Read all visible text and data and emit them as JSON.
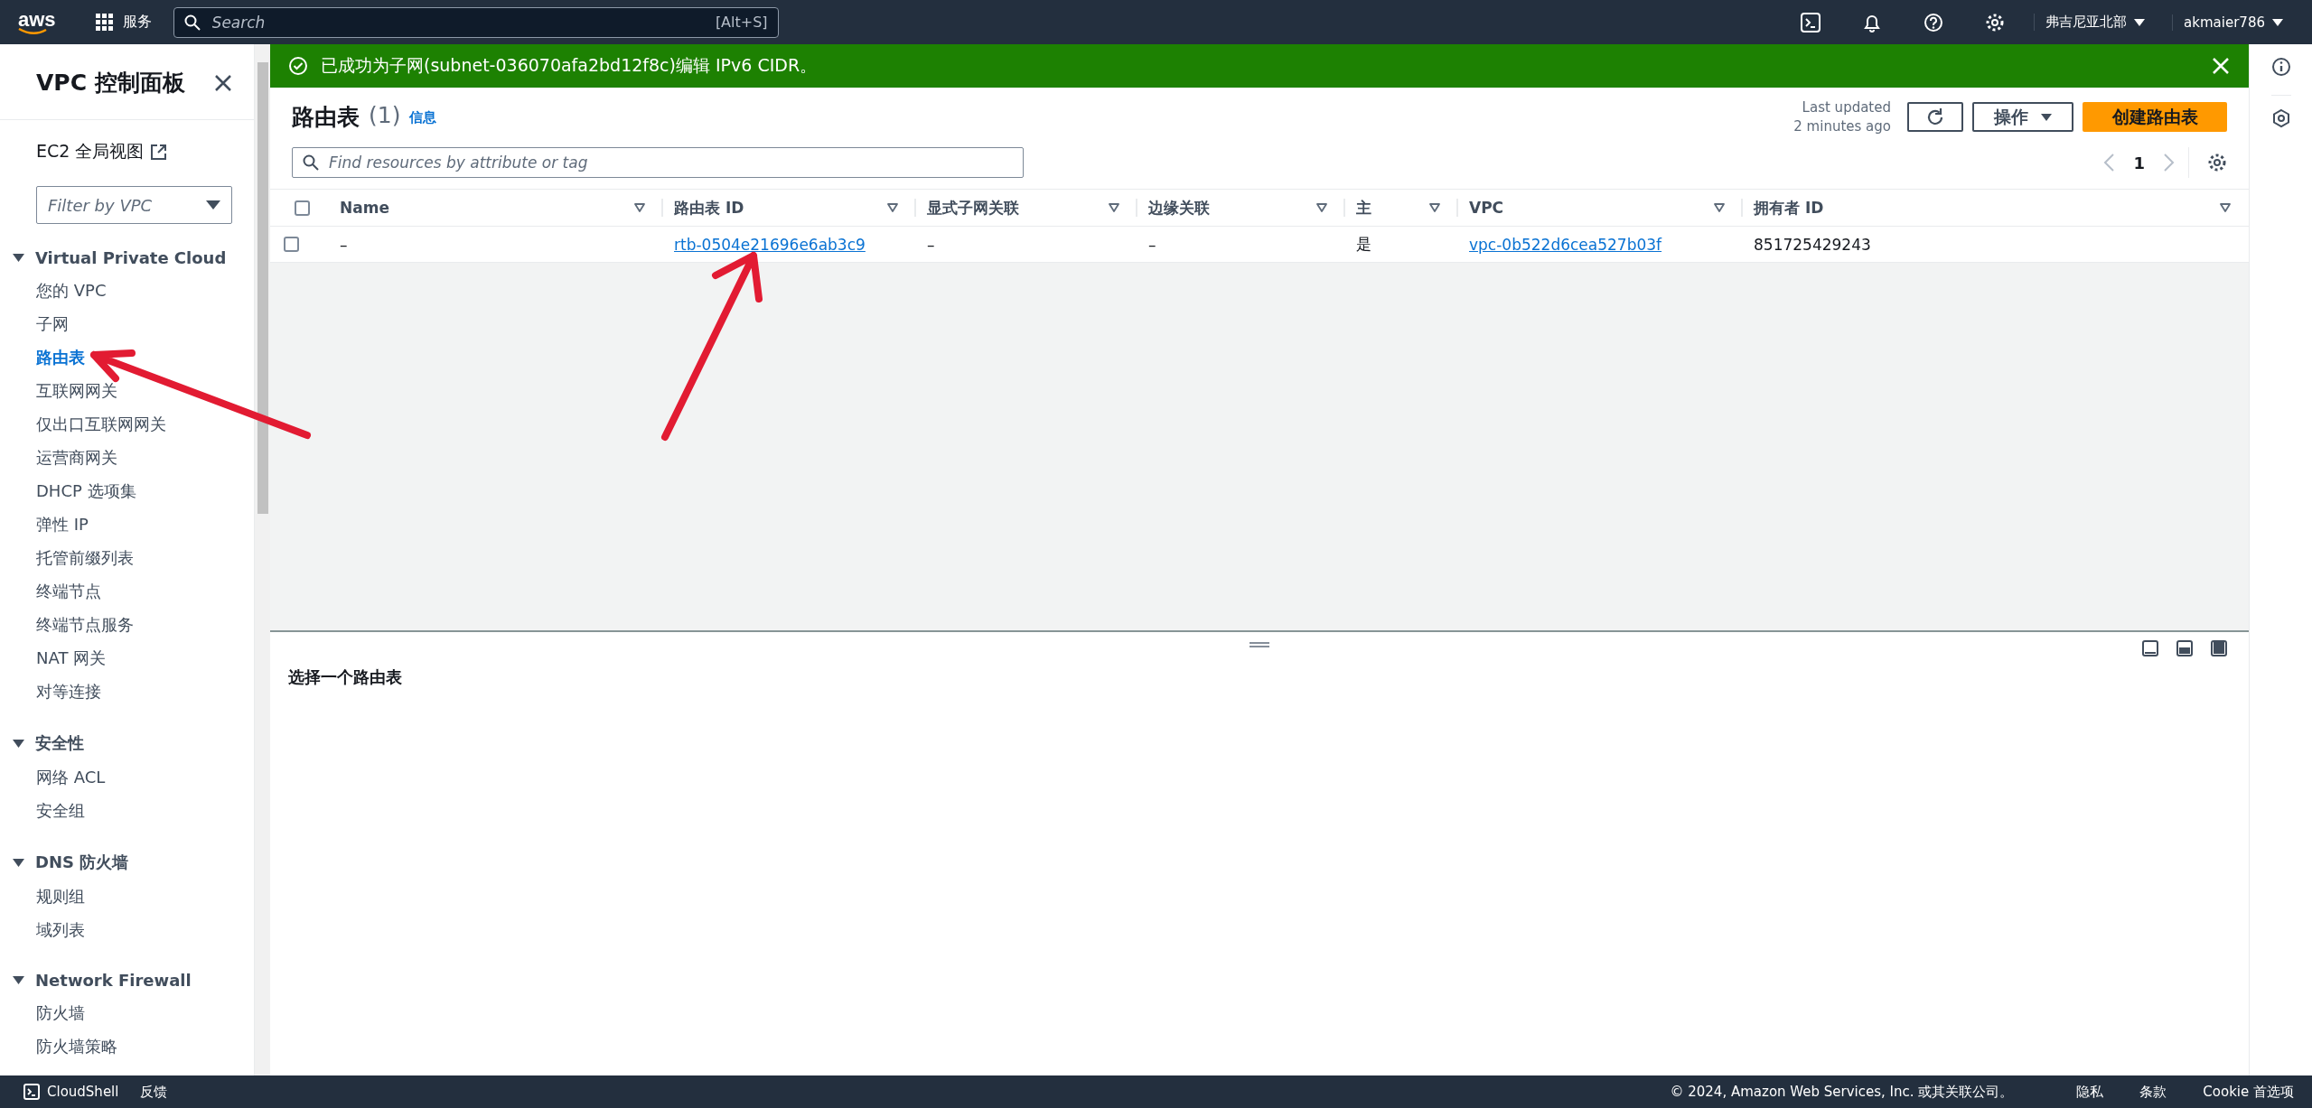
{
  "top_bar": {
    "logo": "aws",
    "services_label": "服务",
    "search": {
      "placeholder": "Search",
      "shortcut": "[Alt+S]"
    },
    "region": "弗吉尼亚北部",
    "user": "akmaier786"
  },
  "sidebar": {
    "title": "VPC 控制面板",
    "global_view_link": "EC2 全局视图",
    "vpc_filter": {
      "placeholder": "Filter by VPC"
    },
    "sections": [
      {
        "title": "Virtual Private Cloud",
        "expanded": true,
        "items": [
          {
            "label": "您的 VPC",
            "selected": false
          },
          {
            "label": "子网",
            "selected": false
          },
          {
            "label": "路由表",
            "selected": true
          },
          {
            "label": "互联网网关",
            "selected": false
          },
          {
            "label": "仅出口互联网网关",
            "selected": false
          },
          {
            "label": "运营商网关",
            "selected": false
          },
          {
            "label": "DHCP 选项集",
            "selected": false
          },
          {
            "label": "弹性 IP",
            "selected": false
          },
          {
            "label": "托管前缀列表",
            "selected": false
          },
          {
            "label": "终端节点",
            "selected": false
          },
          {
            "label": "终端节点服务",
            "selected": false
          },
          {
            "label": "NAT 网关",
            "selected": false
          },
          {
            "label": "对等连接",
            "selected": false
          }
        ]
      },
      {
        "title": "安全性",
        "expanded": true,
        "items": [
          {
            "label": "网络 ACL",
            "selected": false
          },
          {
            "label": "安全组",
            "selected": false
          }
        ]
      },
      {
        "title": "DNS 防火墙",
        "expanded": true,
        "items": [
          {
            "label": "规则组",
            "selected": false
          },
          {
            "label": "域列表",
            "selected": false
          }
        ]
      },
      {
        "title": "Network Firewall",
        "expanded": true,
        "items": [
          {
            "label": "防火墙",
            "selected": false
          },
          {
            "label": "防火墙策略",
            "selected": false
          }
        ]
      }
    ]
  },
  "flash": {
    "message": "已成功为子网(subnet-036070afa2bd12f8c)编辑 IPv6 CIDR。"
  },
  "table_panel": {
    "title": "路由表",
    "count": "(1)",
    "info_link": "信息",
    "last_updated_label": "Last updated",
    "last_updated_time": "2 minutes ago",
    "actions_button": "操作",
    "create_button": "创建路由表",
    "search": {
      "placeholder": "Find resources by attribute or tag"
    },
    "page": "1",
    "header_checkbox": {
      "checked": false
    },
    "columns": [
      "Name",
      "路由表 ID",
      "显式子网关联",
      "边缘关联",
      "主",
      "VPC",
      "拥有者 ID"
    ],
    "rows": [
      {
        "selected": false,
        "cells": [
          {
            "text": "–",
            "kind": "text"
          },
          {
            "text": "rtb-0504e21696e6ab3c9",
            "kind": "link"
          },
          {
            "text": "–",
            "kind": "text"
          },
          {
            "text": "–",
            "kind": "text"
          },
          {
            "text": "是",
            "kind": "text"
          },
          {
            "text": "vpc-0b522d6cea527b03f",
            "kind": "link"
          },
          {
            "text": "851725429243",
            "kind": "text"
          }
        ]
      }
    ]
  },
  "split_panel": {
    "title": "选择一个路由表"
  },
  "bottom_bar": {
    "cloudshell": "CloudShell",
    "feedback": "反馈",
    "copyright": "© 2024, Amazon Web Services, Inc. 或其关联公司。",
    "links": [
      "隐私",
      "条款",
      "Cookie 首选项"
    ]
  }
}
